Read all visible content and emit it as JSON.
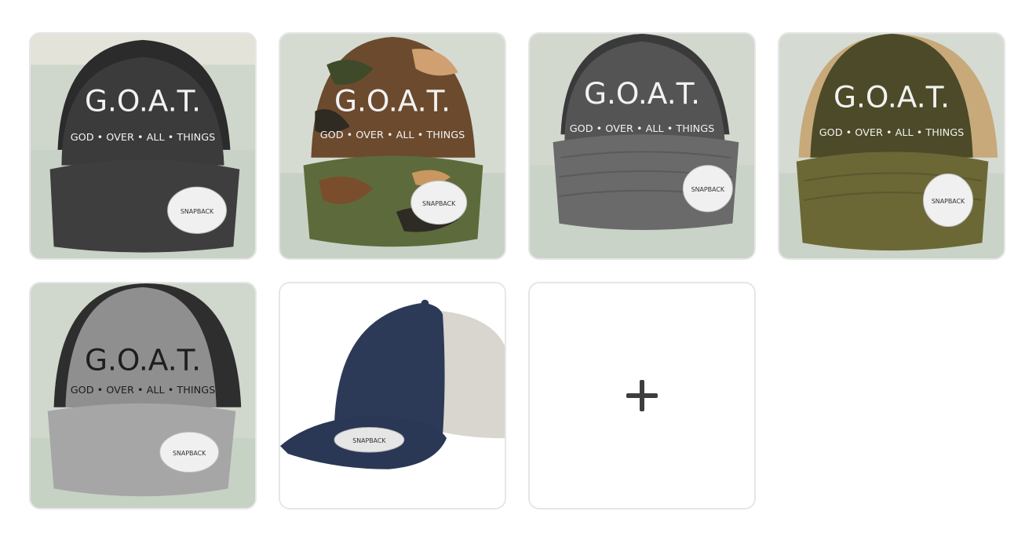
{
  "gallery": {
    "photos": [
      {
        "alt": "",
        "hat_color": "#3b3b3b",
        "mesh_color": "#2b2b2b",
        "logo_color": "#f2f2f2",
        "variant": "black"
      },
      {
        "alt": "",
        "hat_color": "#6b4a2e",
        "mesh_color": "#3a3a3a",
        "logo_color": "#f2f2f2",
        "variant": "camo"
      },
      {
        "alt": "",
        "hat_color": "#5e5e5e",
        "mesh_color": "#3a3a3a",
        "logo_color": "#f2f2f2",
        "variant": "charcoal"
      },
      {
        "alt": "",
        "hat_color": "#5c5a32",
        "mesh_color": "#c7a97a",
        "logo_color": "#f2f2f2",
        "variant": "loden"
      },
      {
        "alt": "",
        "hat_color": "#9a9a9a",
        "mesh_color": "#2e2e2e",
        "logo_color": "#1e1e1e",
        "variant": "heather"
      },
      {
        "alt": "",
        "hat_color": "#2c3a57",
        "mesh_color": "#d9d6cf",
        "logo_color": "",
        "variant": "navy-plain"
      }
    ],
    "hat_text": {
      "title": "G.O.A.T.",
      "subtitle": "GOD • OVER • ALL • THINGS",
      "patch_text": "SNAPBACK"
    },
    "add_button": {
      "icon": "plus-icon",
      "color": "#3d3d3d"
    }
  }
}
